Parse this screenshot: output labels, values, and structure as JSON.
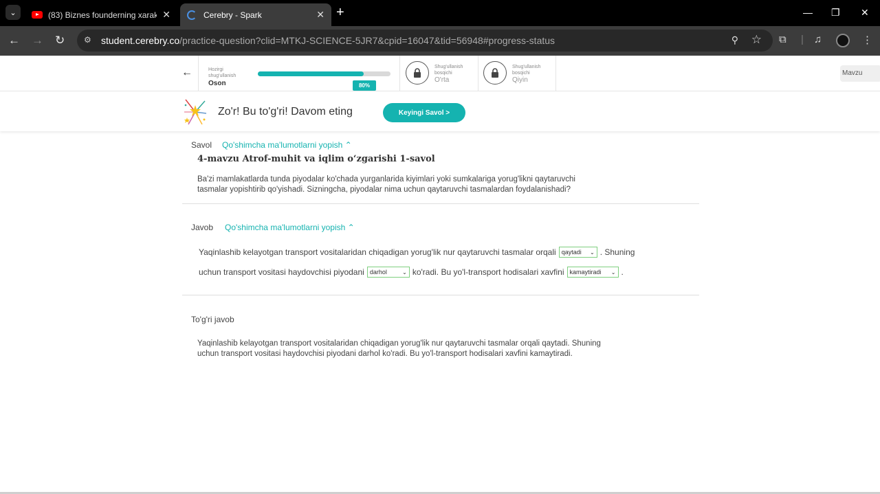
{
  "browser": {
    "tabs": [
      {
        "title": "(83) Biznes founderning xarakte",
        "active": false
      },
      {
        "title": "Cerebry - Spark",
        "active": true
      }
    ],
    "url_host": "student.cerebry.co",
    "url_path": "/practice-question?clid=MTKJ-SCIENCE-5JR7&cpid=16047&tid=56948#progress-status"
  },
  "progress": {
    "current": {
      "small": "Hozirgi shug'ullanish",
      "name": "Oson"
    },
    "fraction": 0.8,
    "percent_label": "80%",
    "level2": {
      "small": "Shug'ullanish bosqichi",
      "name": "O'rta"
    },
    "level3": {
      "small": "Shug'ullanish bosqichi",
      "name": "Qiyin"
    },
    "mavzu": "Mavzu"
  },
  "banner": {
    "message": "Zo'r! Bu to'g'ri! Davom eting",
    "next_label": "Keyingi Savol >"
  },
  "question": {
    "label": "Savol",
    "toggle": "Qo'shimcha ma'lumotlarni yopish",
    "title": "4-mavzu Atrof-muhit va iqlim o‘zgarishi 1-savol",
    "text_line1": "Ba'zi mamlakatlarda tunda piyodalar ko'chada yurganlarida kiyimlari yoki sumkalariga yorug'likni qaytaruvchi",
    "text_line2": "tasmalar yopishtirib qo'yishadi. Sizningcha, piyodalar nima uchun qaytaruvchi tasmalardan foydalanishadi?"
  },
  "answer": {
    "label": "Javob",
    "toggle": "Qo'shimcha ma'lumotlarni yopish",
    "l1_text": "Yaqinlashib kelayotgan transport vositalaridan chiqadigan yorug'lik nur qaytaruvchi tasmalar orqali",
    "sel1": "qaytadi",
    "l1_end": ". Shuning",
    "l2_text": "uchun transport vositasi haydovchisi piyodani",
    "sel2": "darhol",
    "l2_mid": "ko'radi. Bu yo'l-transport hodisalari xavfini",
    "sel3": "kamaytiradi",
    "l2_end": "."
  },
  "correct": {
    "label": "To'g'ri javob",
    "line1": "Yaqinlashib kelayotgan transport vositalaridan chiqadigan yorug'lik nur qaytaruvchi tasmalar orqali qaytadi. Shuning",
    "line2": "uchun transport vositasi haydovchisi piyodani darhol ko'radi. Bu yo'l-transport hodisalari xavfini kamaytiradi."
  },
  "colors": {
    "accent": "#15b3b0",
    "select_border": "#7ecf7e"
  }
}
